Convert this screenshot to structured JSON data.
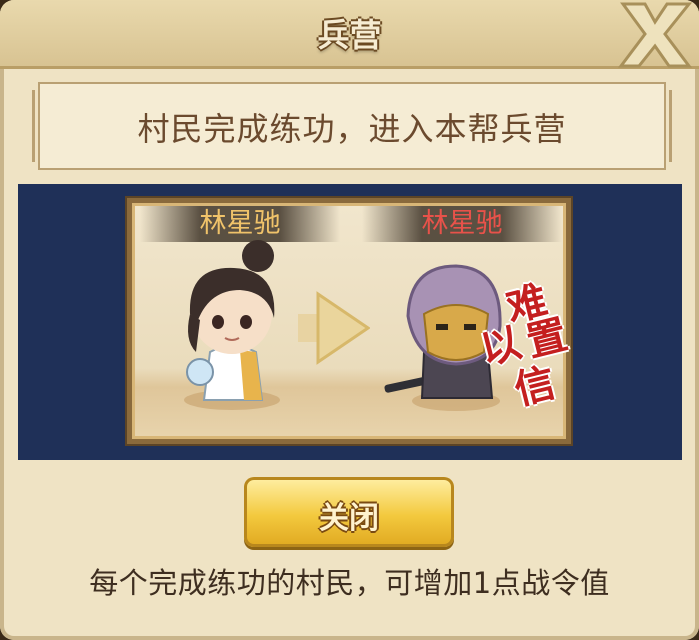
{
  "dialog": {
    "title": "兵营",
    "banner": "村民完成练功，进入本帮兵营",
    "left_name": "林星驰",
    "right_name": "林星驰",
    "stamp_lines": [
      "难",
      "以",
      "置",
      "信"
    ],
    "close_button_label": "关闭",
    "footer_note": "每个完成练功的村民，可增加1点战令值"
  },
  "colors": {
    "panel_bg": "#1f3058",
    "left_name": "#f0c36a",
    "right_name": "#e8524a",
    "button_gold": "#f3c93e"
  },
  "icons": [
    "close-x-icon",
    "arrow-right-icon",
    "villager-portrait",
    "soldier-portrait",
    "stamp-icon"
  ]
}
